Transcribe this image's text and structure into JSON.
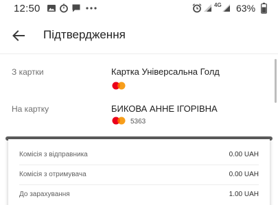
{
  "status_bar": {
    "time": "12:50",
    "battery": "63%",
    "network": "4G",
    "left_icons": [
      "image-icon",
      "timer-icon",
      "message-icon",
      "more-dots-icon"
    ],
    "right_icons": [
      "alarm-icon",
      "signal-icon",
      "signal-4g-icon",
      "battery-icon"
    ]
  },
  "app_bar": {
    "title": "Підтвердження",
    "back_icon": "arrow-back-icon"
  },
  "from_card": {
    "label": "З картки",
    "name": "Картка Універсальна Голд",
    "brand": "mastercard"
  },
  "to_card": {
    "label": "На картку",
    "name": "БИКОВА АННЕ ІГОРІВНА",
    "brand": "mastercard",
    "masked_number": "5363"
  },
  "fees": [
    {
      "label": "Комісія з відправника",
      "value": "0.00 UAH"
    },
    {
      "label": "Комісія з отримувача",
      "value": "0.00 UAH"
    },
    {
      "label": "До зарахування",
      "value": "1.00 UAH"
    }
  ],
  "colors": {
    "mastercard_red": "#eb001b",
    "mastercard_orange": "#f79e1b",
    "mastercard_overlap": "#ff5f00"
  }
}
